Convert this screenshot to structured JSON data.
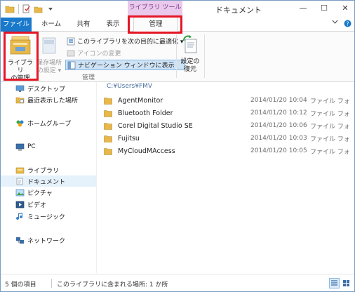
{
  "window": {
    "title": "ドキュメント",
    "contextual_tab_header": "ライブラリ ツール",
    "controls": {
      "minimize": "—",
      "maximize": "☐",
      "close": "✕"
    }
  },
  "tabs": {
    "file": "ファイル",
    "home": "ホーム",
    "share": "共有",
    "view": "表示",
    "manage": "管理"
  },
  "ribbon": {
    "manage_library_label": "ライブラリ\nの管理",
    "save_location_label": "保存場所\nの設定 ▾",
    "optimize_label": "このライブラリを次の目的に最適化 ▾",
    "change_icon_label": "アイコンの変更",
    "show_in_nav_label": "ナビゲーション ウィンドウに表示",
    "restore_label": "設定の\n復元",
    "group_label": "管理"
  },
  "address": {
    "path": "C:¥Users¥FMV"
  },
  "nav": {
    "items": [
      {
        "label": "デスクトップ",
        "icon": "desktop-icon"
      },
      {
        "label": "最近表示した場所",
        "icon": "recent-places-icon"
      },
      {
        "label": "ホームグループ",
        "icon": "homegroup-icon"
      },
      {
        "label": "PC",
        "icon": "computer-icon"
      },
      {
        "label": "ライブラリ",
        "icon": "library-icon"
      },
      {
        "label": "ドキュメント",
        "icon": "documents-icon"
      },
      {
        "label": "ピクチャ",
        "icon": "pictures-icon"
      },
      {
        "label": "ビデオ",
        "icon": "videos-icon"
      },
      {
        "label": "ミュージック",
        "icon": "music-icon"
      },
      {
        "label": "ネットワーク",
        "icon": "network-icon"
      }
    ]
  },
  "files": [
    {
      "name": "AgentMonitor",
      "date": "2014/01/20 10:04",
      "type": "ファイル フォ"
    },
    {
      "name": "Bluetooth Folder",
      "date": "2014/01/20 10:12",
      "type": "ファイル フォ"
    },
    {
      "name": "Corel Digital Studio SE",
      "date": "2014/01/20 10:06",
      "type": "ファイル フォ"
    },
    {
      "name": "Fujitsu",
      "date": "2014/01/20 10:03",
      "type": "ファイル フォ"
    },
    {
      "name": "MyCloudMAccess",
      "date": "2014/01/20 10:05",
      "type": "ファイル フォ"
    }
  ],
  "status": {
    "item_count": "5 個の項目",
    "location": "このライブラリに含まれる場所: 1 か所"
  },
  "colors": {
    "accent": "#1979ca",
    "highlight": "#e51626",
    "contextual": "#e9c9ec",
    "folder": "#e8b94a"
  }
}
